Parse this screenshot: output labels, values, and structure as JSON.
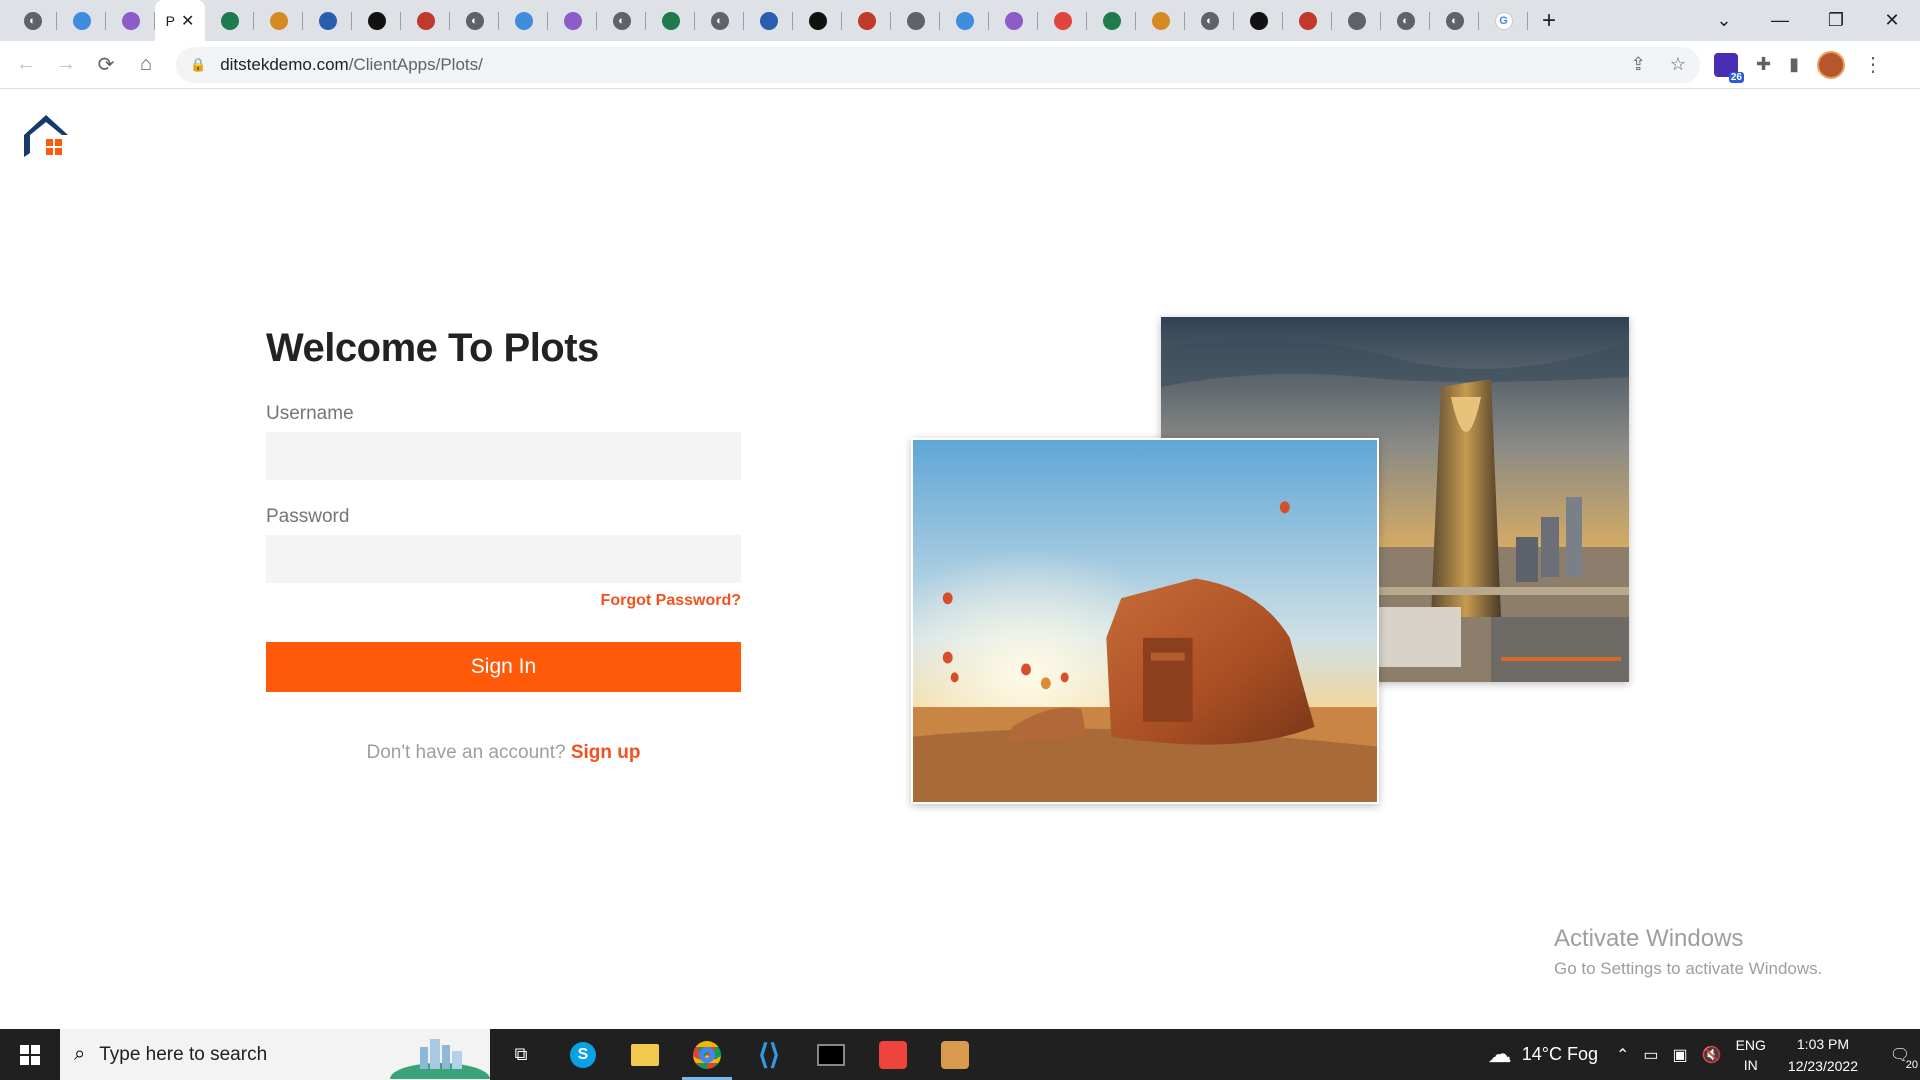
{
  "browser": {
    "active_tab_label": "P",
    "close_glyph": "✕",
    "new_tab_glyph": "+",
    "url_domain": "ditstekdemo.com",
    "url_path": "/ClientApps/Plots/",
    "extension_badge_count": "26",
    "tab_icon_names": [
      "globe-icon",
      "app-icon",
      "app-icon",
      "active-tab",
      "app-icon",
      "app-icon",
      "app-icon",
      "app-icon",
      "app-icon",
      "globe-icon",
      "app-icon",
      "app-icon",
      "globe-icon",
      "app-icon",
      "globe-icon",
      "app-icon",
      "app-icon",
      "app-icon",
      "app-icon",
      "app-icon",
      "app-icon",
      "app-icon",
      "app-icon",
      "app-icon",
      "globe-icon",
      "app-icon",
      "app-icon",
      "app-icon",
      "globe-icon",
      "globe-icon",
      "google-icon"
    ]
  },
  "login": {
    "title": "Welcome To Plots",
    "username_label": "Username",
    "username_value": "",
    "password_label": "Password",
    "password_value": "",
    "forgot_label": "Forgot Password?",
    "signin_label": "Sign In",
    "no_account_text": "Don't have an account?",
    "signup_label": "Sign up"
  },
  "watermark": {
    "heading": "Activate Windows",
    "subtext": "Go to Settings to activate Windows."
  },
  "taskbar": {
    "search_placeholder": "Type here to search",
    "weather": "14°C  Fog",
    "lang_top": "ENG",
    "lang_bottom": "IN",
    "time": "1:03 PM",
    "date": "12/23/2022",
    "notification_count": "20"
  },
  "colors": {
    "accent": "#ff5a0a",
    "link": "#f4511e",
    "logo_navy": "#163a6b"
  }
}
